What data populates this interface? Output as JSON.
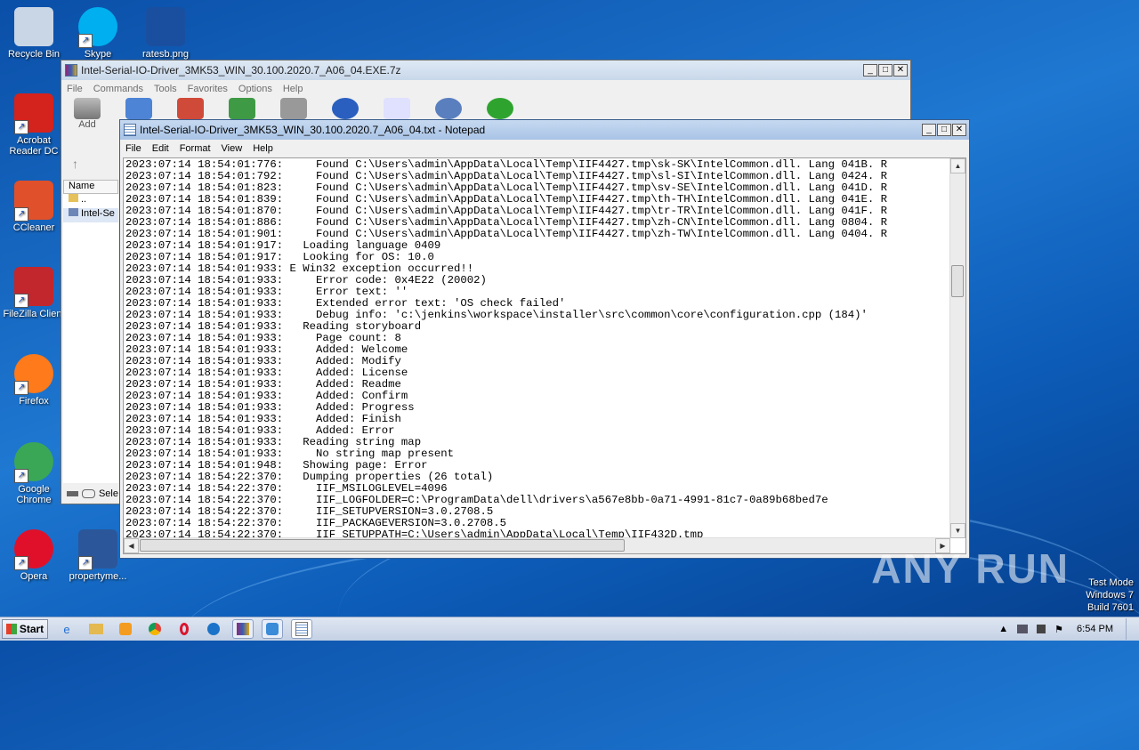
{
  "desktop": {
    "icons": [
      {
        "label": "Recycle Bin",
        "icon": "recycle-bin-icon",
        "color": "#c9d6e6"
      },
      {
        "label": "Skype",
        "icon": "skype-icon",
        "color": "#00aff0"
      },
      {
        "label": "ratesb.png",
        "icon": "image-file-icon",
        "color": "#1a4fa0"
      },
      {
        "label": "Acrobat Reader DC",
        "icon": "acrobat-icon",
        "color": "#d4221d"
      },
      {
        "label": "CCleaner",
        "icon": "ccleaner-icon",
        "color": "#e0502a"
      },
      {
        "label": "FileZilla Client",
        "icon": "filezilla-icon",
        "color": "#c1272d"
      },
      {
        "label": "Firefox",
        "icon": "firefox-icon",
        "color": "#ff7a1a"
      },
      {
        "label": "Google Chrome",
        "icon": "chrome-icon",
        "color": "#3aa757"
      },
      {
        "label": "Opera",
        "icon": "opera-icon",
        "color": "#e0102a"
      },
      {
        "label": "propertyme...",
        "icon": "word-document-icon",
        "color": "#2b579a"
      }
    ]
  },
  "winrar": {
    "title": "Intel-Serial-IO-Driver_3MK53_WIN_30.100.2020.7_A06_04.EXE.7z",
    "menu": [
      "File",
      "Commands",
      "Tools",
      "Favorites",
      "Options",
      "Help"
    ],
    "toolbar_add": "Add",
    "column_name": "Name",
    "files": [
      "..",
      "Intel-Se"
    ],
    "status_text": "Sele"
  },
  "notepad": {
    "title": "Intel-Serial-IO-Driver_3MK53_WIN_30.100.2020.7_A06_04.txt - Notepad",
    "menu": [
      "File",
      "Edit",
      "Format",
      "View",
      "Help"
    ],
    "lines": [
      "2023:07:14 18:54:01:776:     Found C:\\Users\\admin\\AppData\\Local\\Temp\\IIF4427.tmp\\sk-SK\\IntelCommon.dll. Lang 041B. R",
      "2023:07:14 18:54:01:792:     Found C:\\Users\\admin\\AppData\\Local\\Temp\\IIF4427.tmp\\sl-SI\\IntelCommon.dll. Lang 0424. R",
      "2023:07:14 18:54:01:823:     Found C:\\Users\\admin\\AppData\\Local\\Temp\\IIF4427.tmp\\sv-SE\\IntelCommon.dll. Lang 041D. R",
      "2023:07:14 18:54:01:839:     Found C:\\Users\\admin\\AppData\\Local\\Temp\\IIF4427.tmp\\th-TH\\IntelCommon.dll. Lang 041E. R",
      "2023:07:14 18:54:01:870:     Found C:\\Users\\admin\\AppData\\Local\\Temp\\IIF4427.tmp\\tr-TR\\IntelCommon.dll. Lang 041F. R",
      "2023:07:14 18:54:01:886:     Found C:\\Users\\admin\\AppData\\Local\\Temp\\IIF4427.tmp\\zh-CN\\IntelCommon.dll. Lang 0804. R",
      "2023:07:14 18:54:01:901:     Found C:\\Users\\admin\\AppData\\Local\\Temp\\IIF4427.tmp\\zh-TW\\IntelCommon.dll. Lang 0404. R",
      "2023:07:14 18:54:01:917:   Loading language 0409",
      "2023:07:14 18:54:01:917:   Looking for OS: 10.0",
      "2023:07:14 18:54:01:933: E Win32 exception occurred!!",
      "2023:07:14 18:54:01:933:     Error code: 0x4E22 (20002)",
      "2023:07:14 18:54:01:933:     Error text: ''",
      "2023:07:14 18:54:01:933:     Extended error text: 'OS check failed'",
      "2023:07:14 18:54:01:933:     Debug info: 'c:\\jenkins\\workspace\\installer\\src\\common\\core\\configuration.cpp (184)'",
      "2023:07:14 18:54:01:933:   Reading storyboard",
      "2023:07:14 18:54:01:933:     Page count: 8",
      "2023:07:14 18:54:01:933:     Added: Welcome",
      "2023:07:14 18:54:01:933:     Added: Modify",
      "2023:07:14 18:54:01:933:     Added: License",
      "2023:07:14 18:54:01:933:     Added: Readme",
      "2023:07:14 18:54:01:933:     Added: Confirm",
      "2023:07:14 18:54:01:933:     Added: Progress",
      "2023:07:14 18:54:01:933:     Added: Finish",
      "2023:07:14 18:54:01:933:     Added: Error",
      "2023:07:14 18:54:01:933:   Reading string map",
      "2023:07:14 18:54:01:933:     No string map present",
      "2023:07:14 18:54:01:948:   Showing page: Error",
      "2023:07:14 18:54:22:370:   Dumping properties (26 total)",
      "2023:07:14 18:54:22:370:     IIF_MSILOGLEVEL=4096",
      "2023:07:14 18:54:22:370:     IIF_LOGFOLDER=C:\\ProgramData\\dell\\drivers\\a567e8bb-0a71-4991-81c7-0a89b68bed7e",
      "2023:07:14 18:54:22:370:     IIF_SETUPVERSION=3.0.2708.5",
      "2023:07:14 18:54:22:370:     IIF_PACKAGEVERSION=3.0.2708.5",
      "2023:07:14 18:54:22:370:     IIF_SETUPPATH=C:\\Users\\admin\\AppData\\Local\\Temp\\IIF432D.tmp"
    ]
  },
  "taskbar": {
    "start_label": "Start",
    "clock": "6:54 PM"
  },
  "watermark": "ANY RUN",
  "os_info": {
    "line1": "Test Mode",
    "line2": "Windows 7",
    "line3": "Build 7601"
  }
}
